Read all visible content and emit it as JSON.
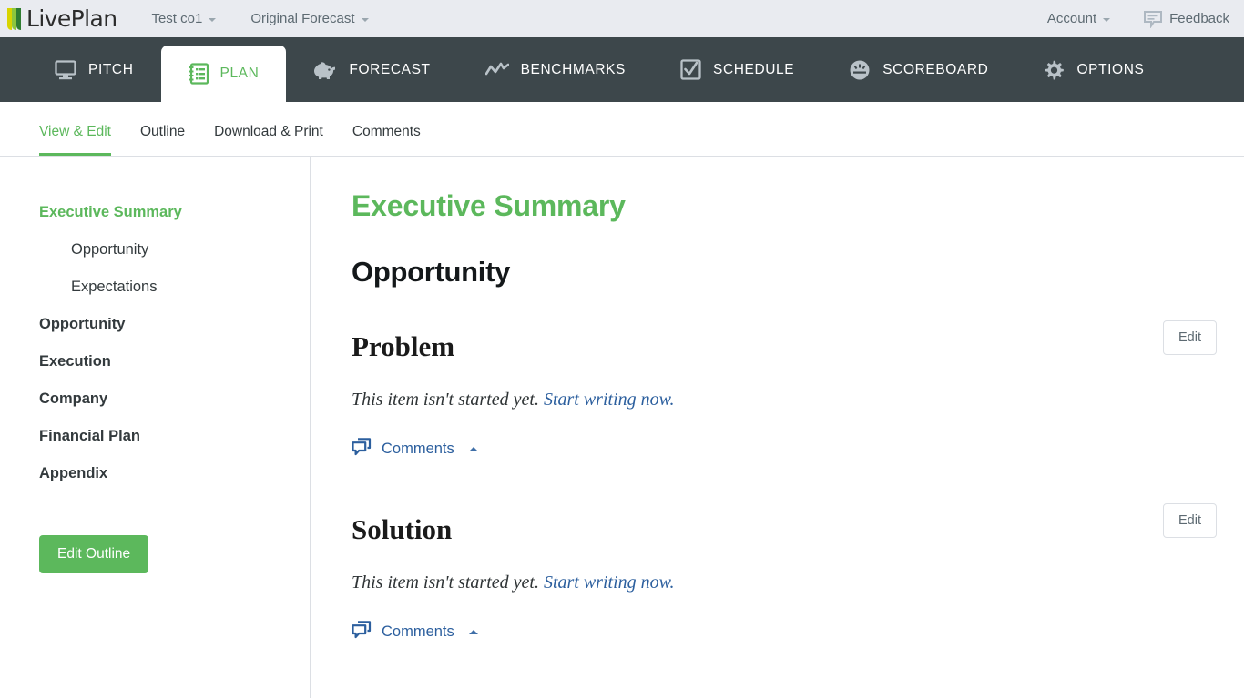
{
  "header": {
    "logo_text": "LivePlan",
    "company_selector": "Test co1",
    "forecast_selector": "Original Forecast",
    "account_label": "Account",
    "feedback_label": "Feedback"
  },
  "main_nav": {
    "tabs": [
      {
        "label": "PITCH",
        "icon": "monitor-icon",
        "active": false
      },
      {
        "label": "PLAN",
        "icon": "notebook-icon",
        "active": true
      },
      {
        "label": "FORECAST",
        "icon": "piggy-bank-icon",
        "active": false
      },
      {
        "label": "BENCHMARKS",
        "icon": "line-chart-icon",
        "active": false
      },
      {
        "label": "SCHEDULE",
        "icon": "checkbox-icon",
        "active": false
      },
      {
        "label": "SCOREBOARD",
        "icon": "gauge-icon",
        "active": false
      },
      {
        "label": "OPTIONS",
        "icon": "gear-icon",
        "active": false
      }
    ]
  },
  "sub_nav": {
    "tabs": [
      {
        "label": "View & Edit",
        "active": true
      },
      {
        "label": "Outline",
        "active": false
      },
      {
        "label": "Download & Print",
        "active": false
      },
      {
        "label": "Comments",
        "active": false
      }
    ]
  },
  "sidebar": {
    "items": [
      {
        "label": "Executive Summary",
        "level": 0,
        "active": true
      },
      {
        "label": "Opportunity",
        "level": 1,
        "active": false
      },
      {
        "label": "Expectations",
        "level": 1,
        "active": false
      },
      {
        "label": "Opportunity",
        "level": 0,
        "active": false
      },
      {
        "label": "Execution",
        "level": 0,
        "active": false
      },
      {
        "label": "Company",
        "level": 0,
        "active": false
      },
      {
        "label": "Financial Plan",
        "level": 0,
        "active": false
      },
      {
        "label": "Appendix",
        "level": 0,
        "active": false
      }
    ],
    "edit_outline_label": "Edit Outline"
  },
  "content": {
    "plan_title": "Executive Summary",
    "section_title": "Opportunity",
    "edit_label": "Edit",
    "comments_label": "Comments",
    "items": [
      {
        "title": "Problem",
        "empty_prefix": "This item isn't started yet. ",
        "empty_link": "Start writing now."
      },
      {
        "title": "Solution",
        "empty_prefix": "This item isn't started yet. ",
        "empty_link": "Start writing now."
      }
    ]
  },
  "colors": {
    "brand_green": "#5cb85c",
    "nav_dark": "#3d474b",
    "header_bg": "#e9ebf0",
    "link_blue": "#2c5f9e"
  }
}
